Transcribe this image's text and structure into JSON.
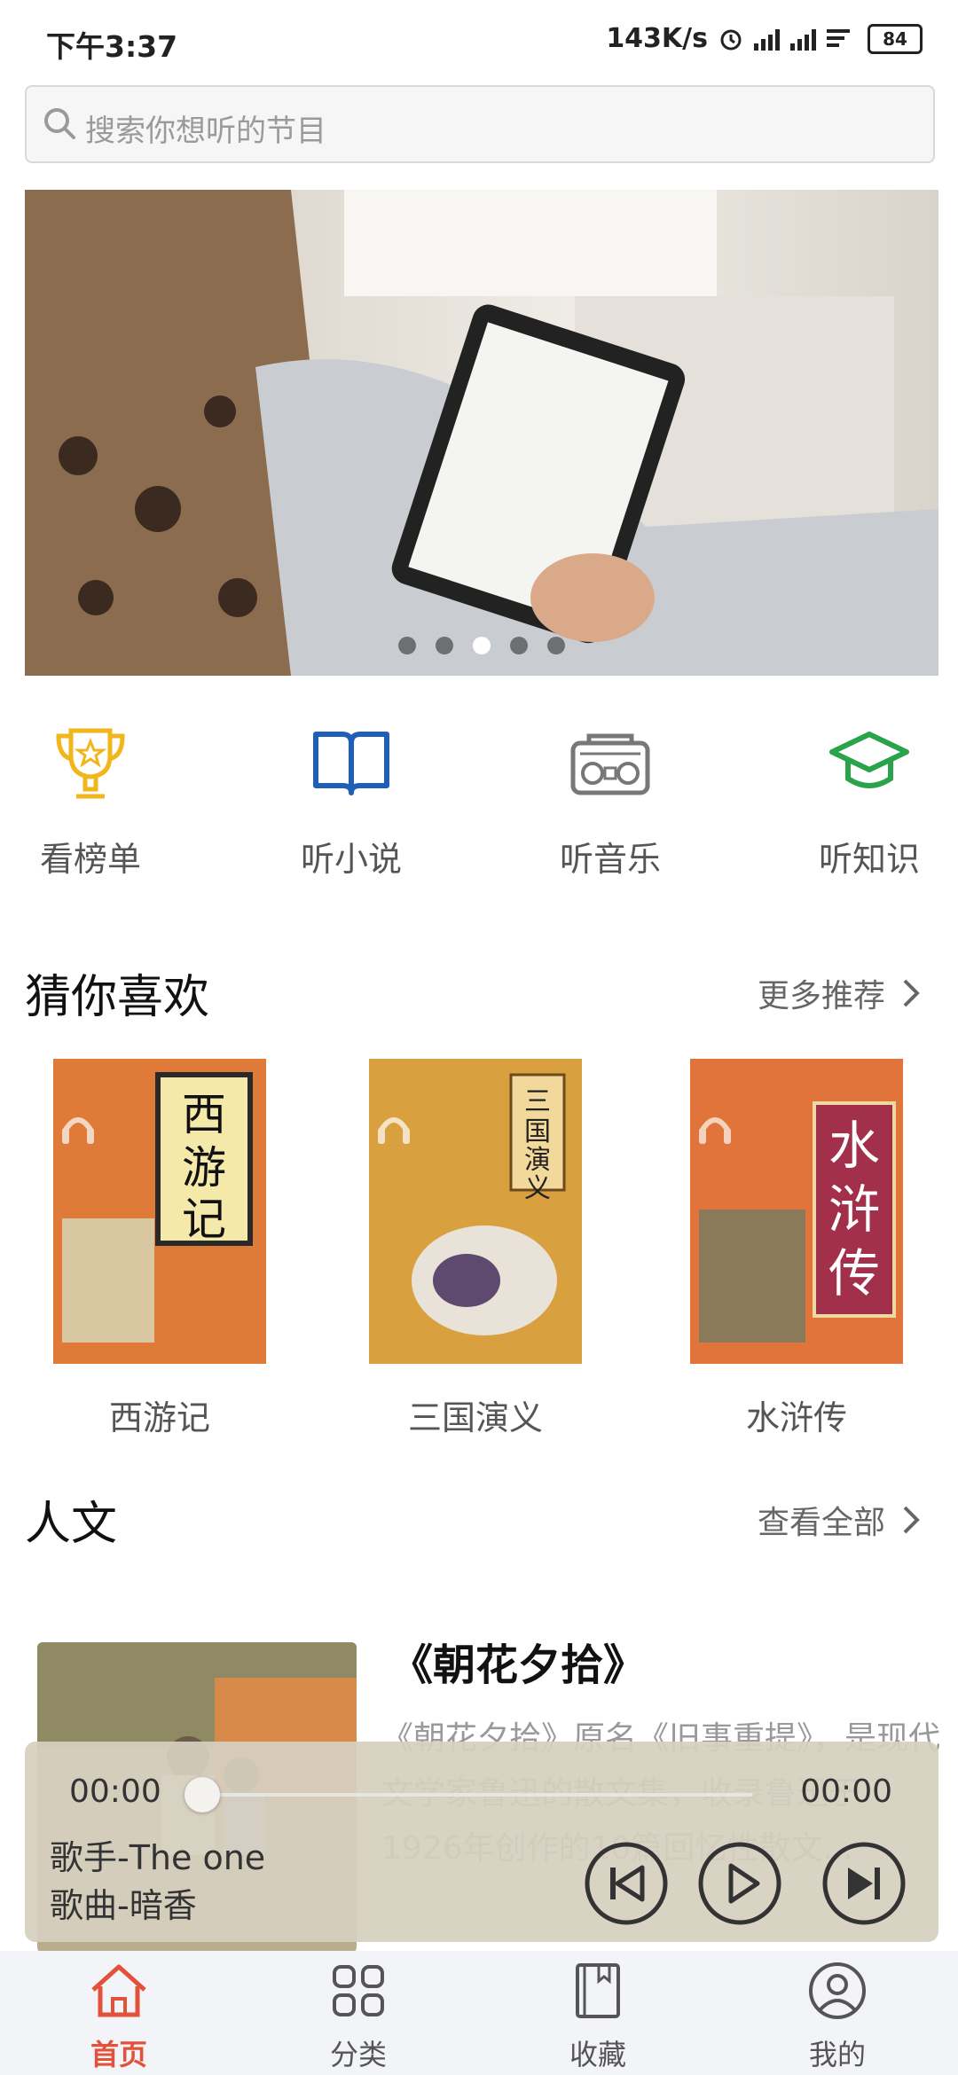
{
  "status_bar": {
    "time": "下午3:37",
    "speed": "143K/s",
    "battery": "84"
  },
  "search": {
    "placeholder": "搜索你想听的节目"
  },
  "banner": {
    "dots": 5,
    "active_dot": 3
  },
  "categories": [
    {
      "label": "看榜单",
      "icon": "trophy-icon",
      "color": "#f2b61d"
    },
    {
      "label": "听小说",
      "icon": "book-open-icon",
      "color": "#1f5fb8"
    },
    {
      "label": "听音乐",
      "icon": "radio-icon",
      "color": "#777777"
    },
    {
      "label": "听知识",
      "icon": "graduation-cap-icon",
      "color": "#2aa34a"
    }
  ],
  "recommend": {
    "title": "猜你喜欢",
    "more": "更多推荐",
    "books": [
      {
        "title": "西游记",
        "cover_text": "西游记"
      },
      {
        "title": "三国演义",
        "cover_text": "三国演义"
      },
      {
        "title": "水浒传",
        "cover_text": "水浒传"
      }
    ]
  },
  "humanities": {
    "title": "人文",
    "more": "查看全部",
    "article": {
      "title": "《朝花夕拾》",
      "desc": "《朝花夕拾》原名《旧事重提》，是现代文学家鲁迅的散文集，收录鲁迅于1926年创作的10篇回忆性散文..."
    }
  },
  "player": {
    "current_time": "00:00",
    "total_time": "00:00",
    "progress": 0,
    "singer": "歌手-The one",
    "song": "歌曲-暗香"
  },
  "nav": {
    "active": "首页",
    "items": [
      "首页",
      "分类",
      "收藏",
      "我的"
    ]
  },
  "colors": {
    "accent": "#e2523b",
    "nav_bg": "#f2f4f8"
  }
}
